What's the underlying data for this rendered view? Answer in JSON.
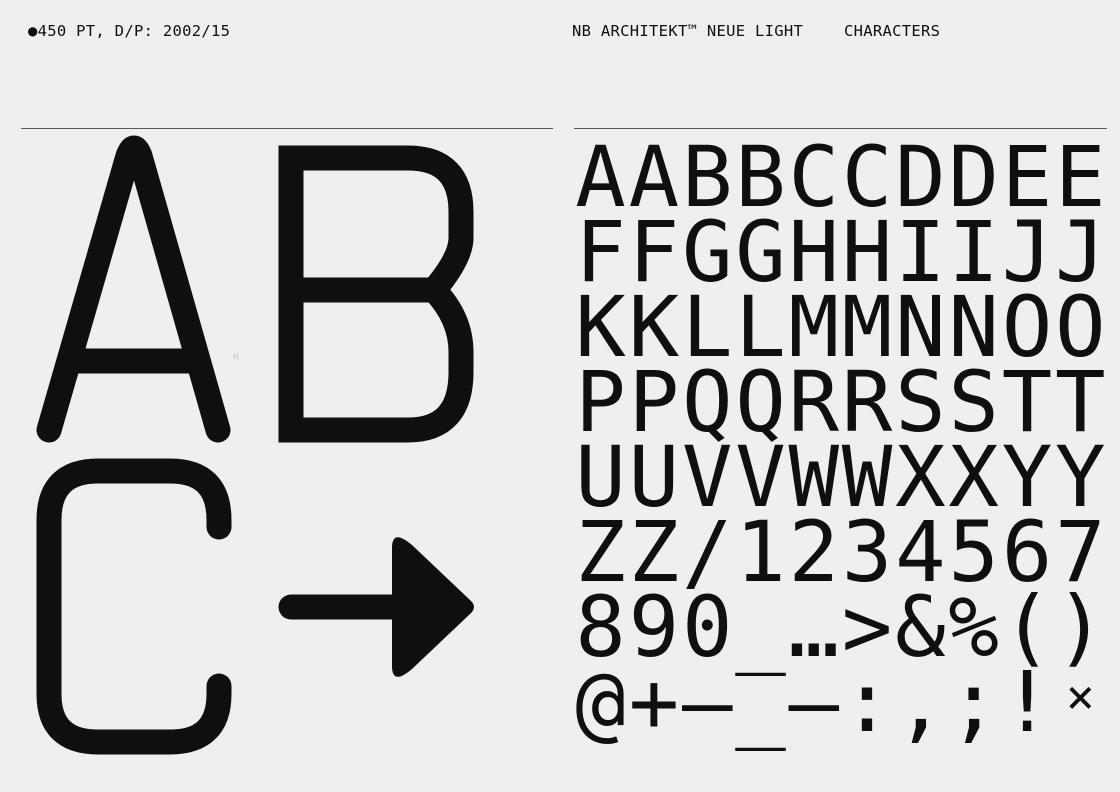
{
  "header": {
    "size_info": "●450 PT, D/P: 2002/15",
    "font_name": "NB ARCHITEKT™ NEUE LIGHT",
    "section": "CHARACTERS"
  },
  "specimen": {
    "glyphs": [
      "A",
      "B",
      "C",
      "arrow-right"
    ],
    "tiny_label": "H"
  },
  "charset": {
    "rows": [
      [
        "A",
        "A",
        "B",
        "B",
        "C",
        "C",
        "D",
        "D",
        "E",
        "E"
      ],
      [
        "F",
        "F",
        "G",
        "G",
        "H",
        "H",
        "I",
        "I",
        "J",
        "J"
      ],
      [
        "K",
        "K",
        "L",
        "L",
        "M",
        "M",
        "N",
        "N",
        "O",
        "O"
      ],
      [
        "P",
        "P",
        "Q",
        "Q",
        "R",
        "R",
        "S",
        "S",
        "T",
        "T"
      ],
      [
        "U",
        "U",
        "V",
        "V",
        "W",
        "W",
        "X",
        "X",
        "Y",
        "Y"
      ],
      [
        "Z",
        "Z",
        "/",
        "1",
        "2",
        "3",
        "4",
        "5",
        "6",
        "7"
      ],
      [
        "8",
        "9",
        "0",
        "_",
        "…",
        ">",
        "&",
        "%",
        "(",
        ")"
      ],
      [
        "@",
        "+",
        "–",
        "_",
        "—",
        ":",
        ",",
        ";",
        "!",
        "×"
      ]
    ]
  },
  "colors": {
    "background": "#efefef",
    "ink": "#0f0f0f",
    "rule": "#5a5a5a"
  }
}
